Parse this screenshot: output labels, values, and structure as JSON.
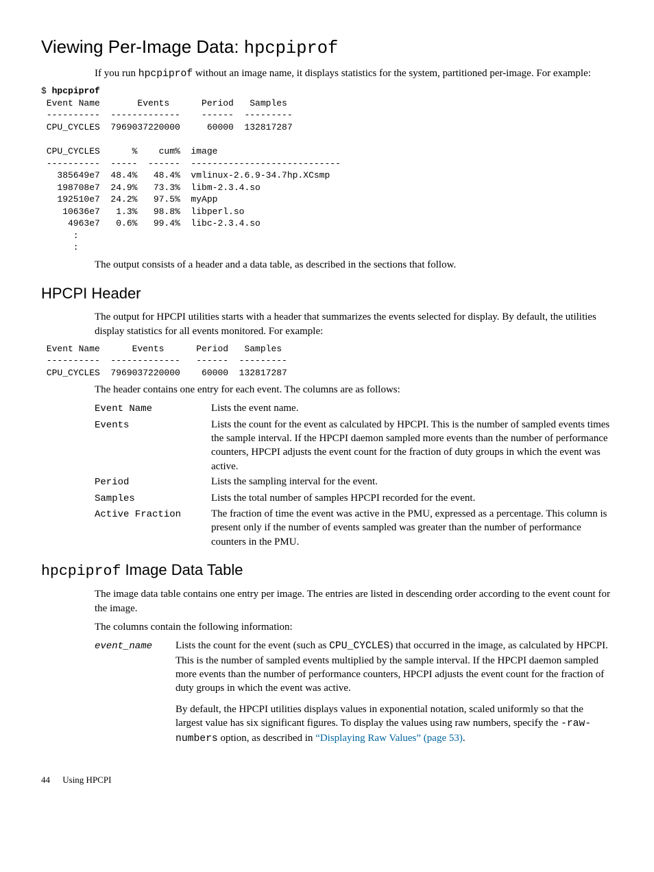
{
  "section1": {
    "title_pre": "Viewing Per-Image Data: ",
    "title_code": "hpcpiprof",
    "para1_a": "If you run ",
    "para1_code": "hpcpiprof",
    "para1_b": " without an image name, it displays statistics for the system, partitioned per-image. For example:",
    "code": "$ hpcpiprof\n Event Name       Events      Period   Samples\n ----------  -------------    ------  ---------\n CPU_CYCLES  7969037220000     60000  132817287\n\n CPU_CYCLES      %    cum%  image\n ----------  -----  ------  ----------------------------\n   385649e7  48.4%   48.4%  vmlinux-2.6.9-34.7hp.XCsmp\n   198708e7  24.9%   73.3%  libm-2.3.4.so\n   192510e7  24.2%   97.5%  myApp\n    10636e7   1.3%   98.8%  libperl.so\n     4963e7   0.6%   99.4%  libc-2.3.4.so\n      :\n      :",
    "para2": "The output consists of a header and a data table, as described in the sections that follow."
  },
  "section2": {
    "title": "HPCPI Header",
    "para1": "The output for HPCPI utilities starts with a header that summarizes the events selected for display. By default, the utilities display statistics for all events monitored. For example:",
    "code": " Event Name      Events      Period   Samples\n ----------  -------------   ------  ---------\n CPU_CYCLES  7969037220000    60000  132817287",
    "para2": "The header contains one entry for each event. The columns are as follows:",
    "defs": [
      {
        "term": "Event Name",
        "desc": "Lists the event name."
      },
      {
        "term": "Events",
        "desc": "Lists the count for the event as calculated by HPCPI. This is the number of sampled events times the sample interval. If the HPCPI daemon sampled more events than the number of performance counters, HPCPI adjusts the event count for the fraction of duty groups in which the event was active."
      },
      {
        "term": "Period",
        "desc": "Lists the sampling interval for the event."
      },
      {
        "term": "Samples",
        "desc": "Lists the total number of samples HPCPI recorded for the event."
      },
      {
        "term": "Active Fraction",
        "desc": "The fraction of time the event was active in the PMU, expressed as a percentage. This column is present only if the number of events sampled was greater than the number of performance counters in the PMU."
      }
    ]
  },
  "section3": {
    "title_code": "hpcpiprof",
    "title_rest": " Image Data Table",
    "para1": "The image data table contains one entry per image. The entries are listed in descending order according to the event count for the image.",
    "para2": "The columns contain the following information:",
    "def_term": "event_name",
    "def_desc1_a": "Lists the count for the event (such as ",
    "def_desc1_code": "CPU_CYCLES",
    "def_desc1_b": ") that occurred in the image, as calculated by HPCPI. This is the number of sampled events multiplied by the sample interval. If the HPCPI daemon sampled more events than the number of performance counters, HPCPI adjusts the event count for the fraction of duty groups in which the event was active.",
    "def_desc2_a": "By default, the HPCPI utilities displays values in exponential notation, scaled uniformly so that the largest value has six significant figures. To display the values using raw numbers, specify the ",
    "def_desc2_code": "-raw-numbers",
    "def_desc2_b": " option, as described in ",
    "def_desc2_link": "“Displaying Raw Values” (page 53)",
    "def_desc2_c": "."
  },
  "footer": {
    "page": "44",
    "label": "Using HPCPI"
  }
}
